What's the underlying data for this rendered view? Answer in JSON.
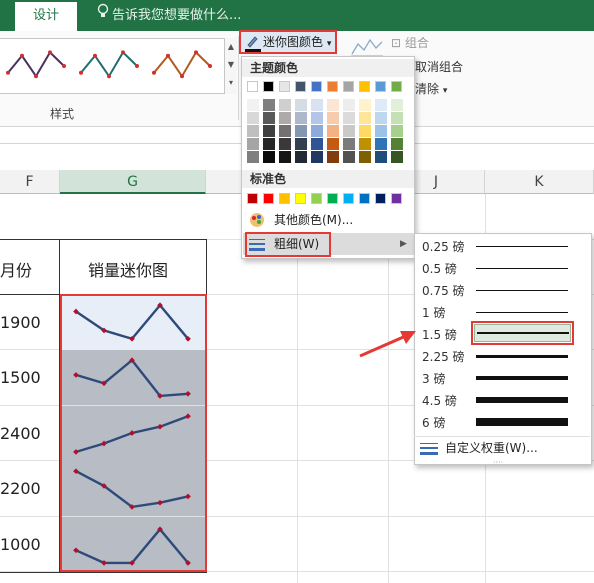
{
  "tabs": {
    "active": "设计"
  },
  "tellme": "告诉我您想要做什么...",
  "ribbon": {
    "styles_label": "样式",
    "color_button": "迷你图颜色",
    "group_label": "组合",
    "ungroup_label": "取消组合",
    "clear_label": "清除",
    "gallery_colors": [
      "#4b2f5f",
      "#1f6e6e",
      "#b25a1e"
    ],
    "marker_color": "#d32f2f"
  },
  "columns": {
    "f": "F",
    "g": "G",
    "j": "J",
    "k": "K"
  },
  "table": {
    "header_f": "月份",
    "header_g": "销量迷你图",
    "rows": [
      "1900",
      "1500",
      "2400",
      "2200",
      "1000"
    ],
    "sparkline_color": "#2e4a7a",
    "marker_color": "#b0102a",
    "sparklines": [
      [
        0.75,
        0.3,
        0.1,
        0.9,
        0.1
      ],
      [
        0.55,
        0.35,
        0.9,
        0.05,
        0.1
      ],
      [
        0.05,
        0.25,
        0.5,
        0.65,
        0.9
      ],
      [
        0.9,
        0.55,
        0.05,
        0.15,
        0.3
      ],
      [
        0.35,
        0.05,
        0.05,
        0.85,
        0.05
      ]
    ]
  },
  "menu": {
    "theme_colors_label": "主题颜色",
    "standard_colors_label": "标准色",
    "more_colors": "其他颜色(M)...",
    "weight": "粗细(W)",
    "theme_top": [
      "#ffffff",
      "#000000",
      "#e7e6e6",
      "#44546a",
      "#4472c4",
      "#ed7d31",
      "#a5a5a5",
      "#ffc000",
      "#5b9bd5",
      "#70ad47"
    ],
    "theme_shades": [
      [
        "#f2f2f2",
        "#7f7f7f",
        "#d0cece",
        "#d6dce4",
        "#d9e2f3",
        "#fbe5d5",
        "#ededed",
        "#fff2cc",
        "#deebf6",
        "#e2efd9"
      ],
      [
        "#d8d8d8",
        "#595959",
        "#aeaaaa",
        "#adb9ca",
        "#b4c6e7",
        "#f7cbac",
        "#dbdbdb",
        "#fee599",
        "#bdd7ee",
        "#c5e0b3"
      ],
      [
        "#bfbfbf",
        "#3f3f3f",
        "#757070",
        "#8496b0",
        "#8eaadb",
        "#f4b183",
        "#c9c9c9",
        "#ffd965",
        "#9cc3e5",
        "#a8d08d"
      ],
      [
        "#a5a5a5",
        "#262626",
        "#3a3838",
        "#323f4f",
        "#2f5496",
        "#c55a11",
        "#7b7b7b",
        "#bf9000",
        "#2e75b5",
        "#538135"
      ],
      [
        "#7f7f7f",
        "#0c0c0c",
        "#171616",
        "#222a35",
        "#1f3864",
        "#833c0b",
        "#525252",
        "#7f6000",
        "#1e4e79",
        "#375623"
      ]
    ],
    "standard": [
      "#c00000",
      "#ff0000",
      "#ffc000",
      "#ffff00",
      "#92d050",
      "#00b050",
      "#00b0f0",
      "#0070c0",
      "#002060",
      "#7030a0"
    ]
  },
  "weights": {
    "items": [
      {
        "label": "0.25 磅",
        "pt": 0.25
      },
      {
        "label": "0.5 磅",
        "pt": 0.5
      },
      {
        "label": "0.75 磅",
        "pt": 0.75
      },
      {
        "label": "1 磅",
        "pt": 1
      },
      {
        "label": "1.5 磅",
        "pt": 1.5
      },
      {
        "label": "2.25 磅",
        "pt": 2.25
      },
      {
        "label": "3 磅",
        "pt": 3
      },
      {
        "label": "4.5 磅",
        "pt": 4.5
      },
      {
        "label": "6 磅",
        "pt": 6
      }
    ],
    "selected": "1.5 磅",
    "custom": "自定义权重(W)..."
  }
}
